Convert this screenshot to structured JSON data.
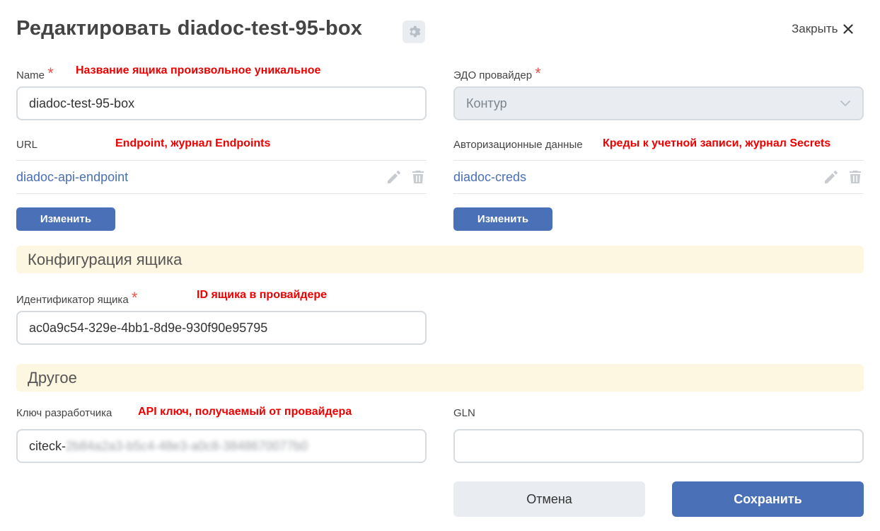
{
  "header": {
    "title": "Редактировать diadoc-test-95-box",
    "close_label": "Закрыть"
  },
  "name_field": {
    "label": "Name",
    "required_mark": "*",
    "note": "Название ящика произвольное уникальное",
    "value": "diadoc-test-95-box"
  },
  "provider_field": {
    "label": "ЭДО провайдер",
    "required_mark": "*",
    "value": "Контур"
  },
  "url_field": {
    "label": "URL",
    "note": "Endpoint, журнал Endpoints",
    "link": "diadoc-api-endpoint",
    "change_label": "Изменить"
  },
  "auth_field": {
    "label": "Авторизационные данные",
    "note": "Креды к учетной записи, журнал Secrets",
    "link": "diadoc-creds",
    "change_label": "Изменить"
  },
  "box_config": {
    "section_title": "Конфигурация ящика",
    "id_label": "Идентификатор ящика",
    "required_mark": "*",
    "note": "ID ящика в провайдере",
    "id_value": "ac0a9c54-329e-4bb1-8d9e-930f90e95795"
  },
  "other": {
    "section_title": "Другое",
    "dev_key_label": "Ключ разработчика",
    "dev_key_note": "API ключ, получаемый от провайдера",
    "dev_key_prefix": "citeck-",
    "dev_key_hidden": "2b84a2a3-b5c4-48e3-a0c8-3848670077b0",
    "gln_label": "GLN",
    "gln_value": ""
  },
  "footer": {
    "cancel_label": "Отмена",
    "save_label": "Сохранить"
  },
  "colors": {
    "accent": "#4a70b7",
    "link": "#4a6fb3",
    "annotation": "#ee0000",
    "required": "#f0534d",
    "section_bg": "#fdf6e0"
  },
  "icons": [
    "gear-icon",
    "close-icon",
    "pencil-icon",
    "trash-icon",
    "chevron-down-icon"
  ]
}
